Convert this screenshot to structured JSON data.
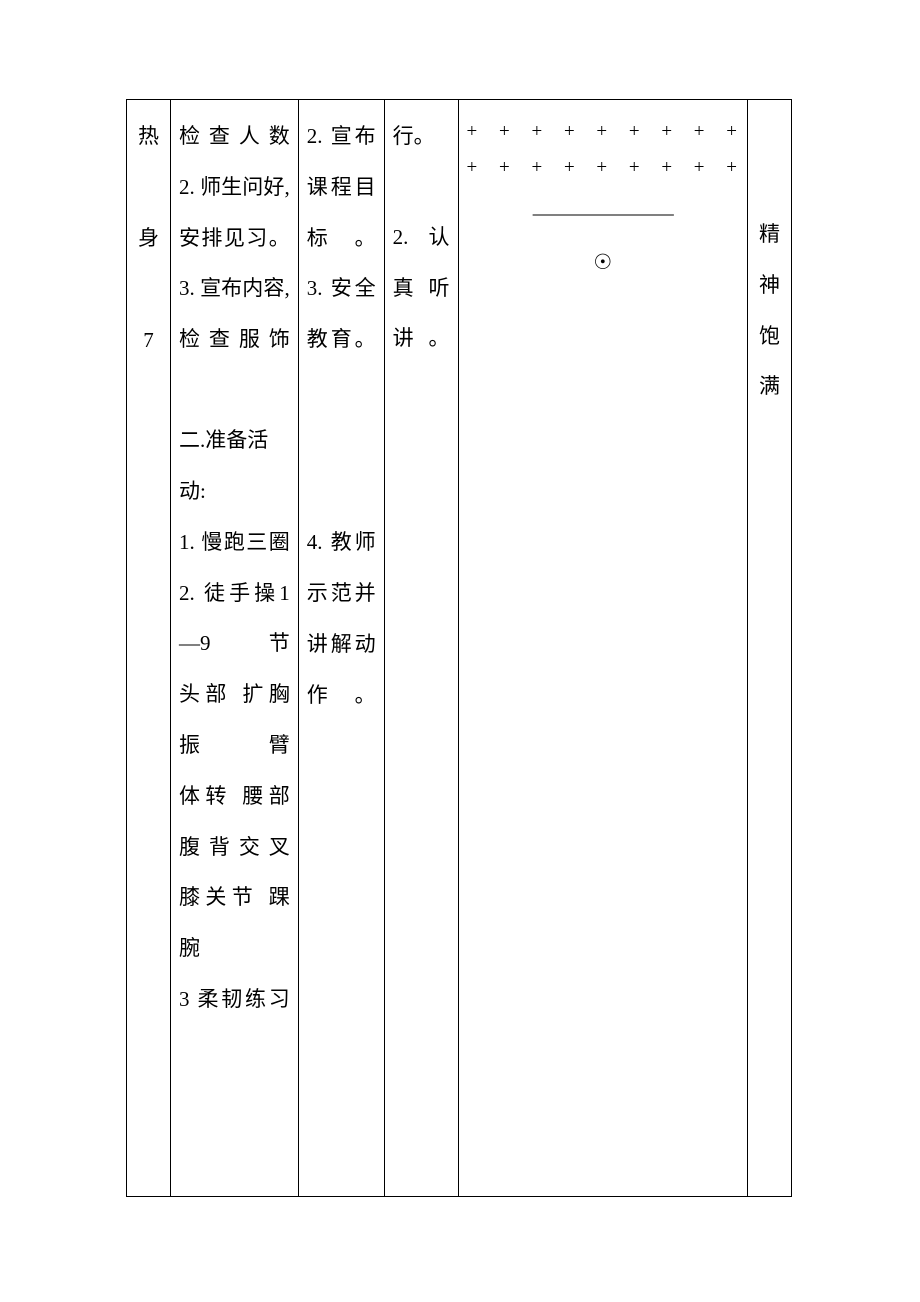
{
  "col1": {
    "line1": "热",
    "line2": "身",
    "line3": "7"
  },
  "col2": {
    "part1": "检查人数\n2. 师生问好,安排见习。\n3. 宣布内容,检查服饰",
    "part2_title": "二.准备活动:",
    "part2_items": "1. 慢跑三圈\n2. 徒手操1—9 节\n头部  扩胸 振臂\n体转  腰部 腹背交叉\n膝关节 踝 腕\n3 柔韧练习"
  },
  "col3": {
    "block1": "2. 宣布课程目标。\n3. 安全教育。",
    "block2": "4. 教师示范并讲解动作。"
  },
  "col4": {
    "block1": "行。",
    "block2": "2. 认真听讲。"
  },
  "col5": {
    "plus_row": "+ + + + + + + + +",
    "dash_row": "———————",
    "circle": "☉"
  },
  "col6": {
    "c1": "精",
    "c2": "神",
    "c3": "饱",
    "c4": "满"
  }
}
